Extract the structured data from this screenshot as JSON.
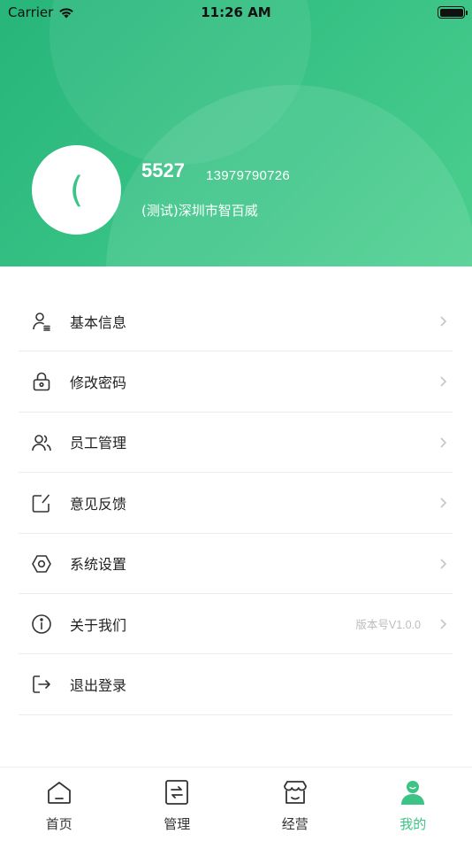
{
  "status_bar": {
    "carrier": "Carrier",
    "time": "11:26 AM"
  },
  "profile": {
    "avatar_text": "(",
    "name": "5527",
    "phone": "13979790726",
    "company": "(测试)深圳市智百威"
  },
  "menu": {
    "items": [
      {
        "label": "基本信息",
        "icon": "user-info-icon",
        "extra": ""
      },
      {
        "label": "修改密码",
        "icon": "lock-icon",
        "extra": ""
      },
      {
        "label": "员工管理",
        "icon": "users-icon",
        "extra": ""
      },
      {
        "label": "意见反馈",
        "icon": "edit-icon",
        "extra": ""
      },
      {
        "label": "系统设置",
        "icon": "settings-hex-icon",
        "extra": ""
      },
      {
        "label": "关于我们",
        "icon": "info-icon",
        "extra": "版本号V1.0.0"
      },
      {
        "label": "退出登录",
        "icon": "logout-icon",
        "extra": ""
      }
    ]
  },
  "tabbar": {
    "tabs": [
      {
        "label": "首页",
        "icon": "home-icon"
      },
      {
        "label": "管理",
        "icon": "manage-icon"
      },
      {
        "label": "经营",
        "icon": "store-icon"
      },
      {
        "label": "我的",
        "icon": "profile-icon"
      }
    ],
    "active_index": 3
  },
  "colors": {
    "accent": "#3cc487",
    "header_gradient_start": "#27b57a",
    "header_gradient_end": "#4ccf8f"
  }
}
